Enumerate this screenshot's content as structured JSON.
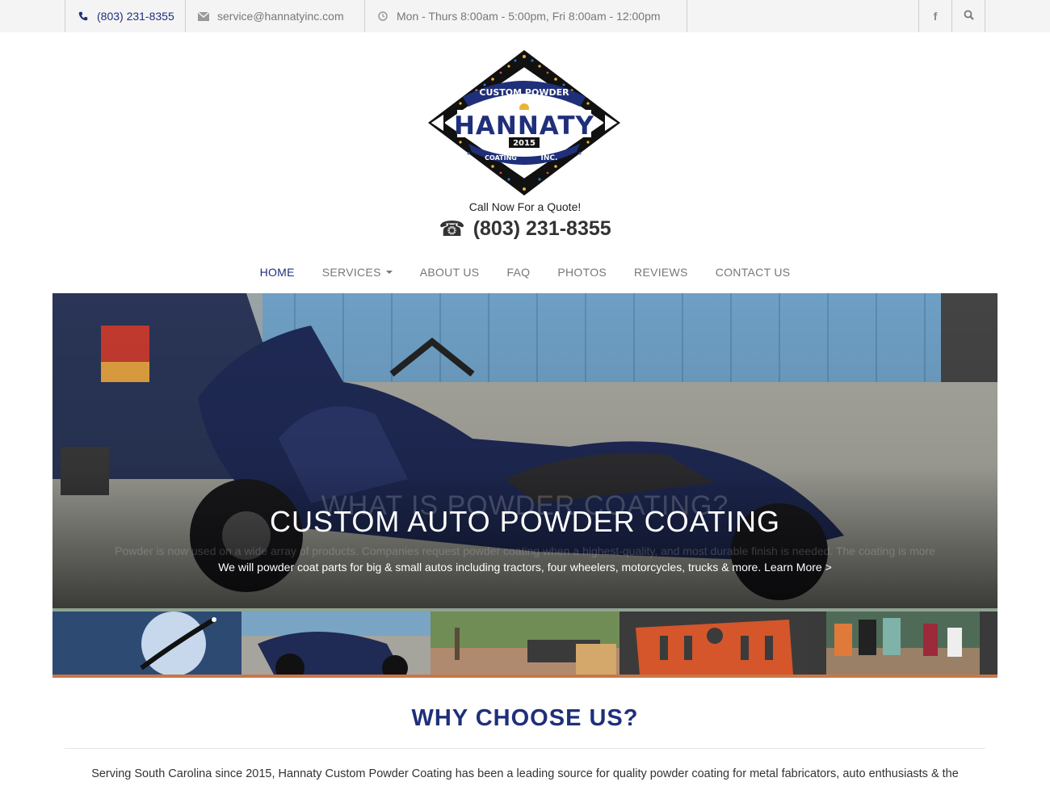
{
  "topbar": {
    "phone": "(803) 231-8355",
    "email": "service@hannatyinc.com",
    "hours": "Mon - Thurs 8:00am - 5:00pm, Fri 8:00am - 12:00pm",
    "icons": [
      "phone-icon",
      "envelope-icon",
      "clock-icon",
      "facebook-icon",
      "search-icon"
    ]
  },
  "logo": {
    "top_text": "CUSTOM POWDER",
    "name": "HANNATY",
    "year": "2015",
    "bottom_left": "COATING",
    "bottom_right": "INC."
  },
  "cta": {
    "label": "Call Now For a Quote!",
    "phone": "(803) 231-8355"
  },
  "nav": {
    "items": [
      {
        "label": "HOME",
        "active": true
      },
      {
        "label": "SERVICES",
        "dropdown": true
      },
      {
        "label": "ABOUT US"
      },
      {
        "label": "FAQ"
      },
      {
        "label": "PHOTOS"
      },
      {
        "label": "REVIEWS"
      },
      {
        "label": "CONTACT US"
      }
    ]
  },
  "hero": {
    "ghost_title": "WHAT IS POWDER COATING?",
    "ghost_text": "Powder is now used on a wide array of products. Companies request powder coating when a highest-quality, and most durable finish is needed. The coating is more",
    "title": "CUSTOM AUTO POWDER COATING",
    "text": "We will powder coat parts for big & small autos including tractors, four wheelers, motorcycles, trucks & more.",
    "more": "Learn More >"
  },
  "colors": {
    "brand": "#1f2f7a",
    "topbar_bg": "#f4f4f4",
    "accent_bar": "#c8774a",
    "nav_text": "#777777"
  },
  "why": {
    "title": "WHY CHOOSE US?",
    "text": "Serving South Carolina since 2015, Hannaty Custom Powder Coating has been a leading source for quality powder coating for metal fabricators, auto enthusiasts & the"
  }
}
